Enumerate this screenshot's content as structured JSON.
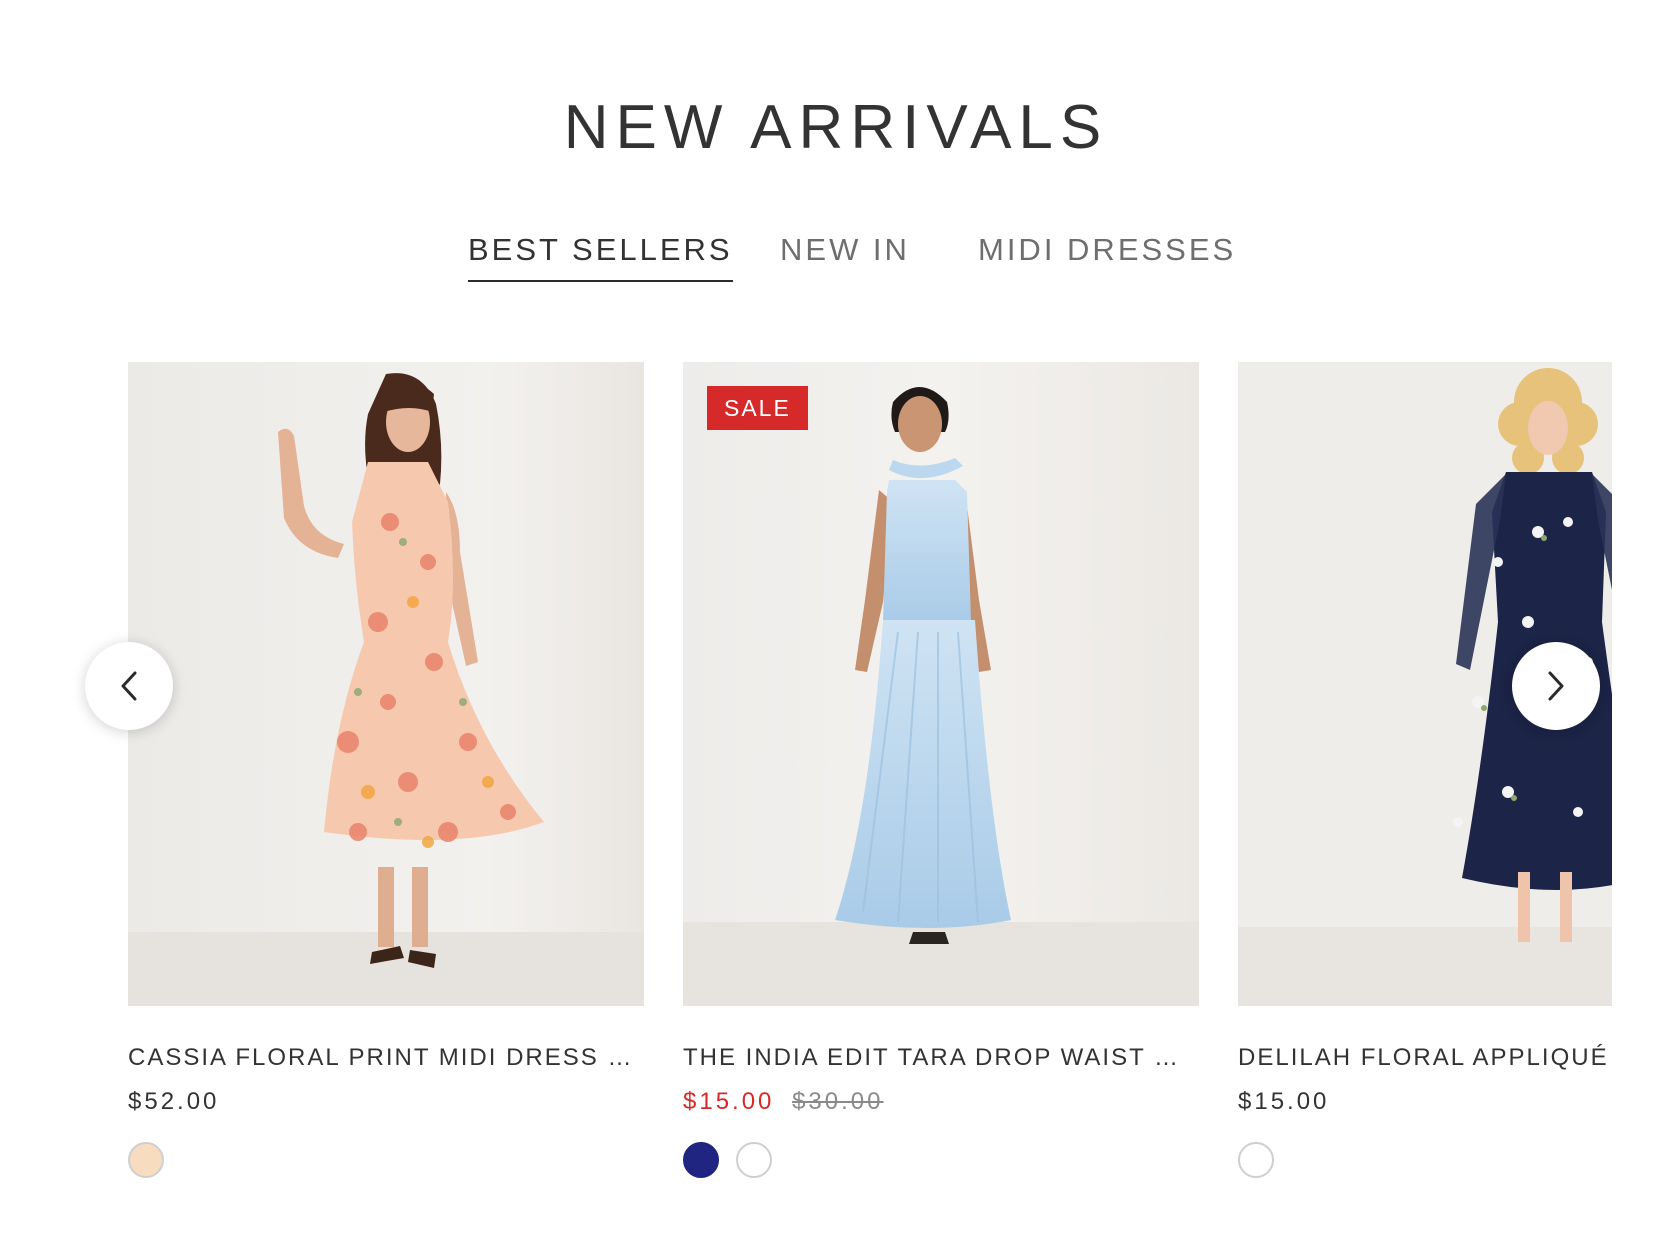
{
  "section_title": "NEW ARRIVALS",
  "tabs": [
    {
      "label": "BEST SELLERS",
      "active": true
    },
    {
      "label": "NEW IN",
      "active": false
    },
    {
      "label": "MIDI DRESSES",
      "active": false
    }
  ],
  "carousel": {
    "prev_icon": "chevron-left-icon",
    "next_icon": "chevron-right-icon",
    "products": [
      {
        "name": "CASSIA FLORAL PRINT MIDI DRESS NUDE",
        "price": "$52.00",
        "swatches": [
          "#f8dcc0"
        ]
      },
      {
        "badge": "SALE",
        "name": "THE INDIA EDIT TARA DROP WAIST MAXI DRESS",
        "price": "$15.00",
        "original_price": "$30.00",
        "swatches": [
          "#1f2580",
          "#ffffff"
        ]
      },
      {
        "name": "DELILAH FLORAL APPLIQUÉ MIDI DRESS",
        "price": "$15.00",
        "swatches": [
          "#ffffff"
        ]
      }
    ]
  },
  "colors": {
    "sale_red": "#d62a2a",
    "text": "#333333"
  }
}
